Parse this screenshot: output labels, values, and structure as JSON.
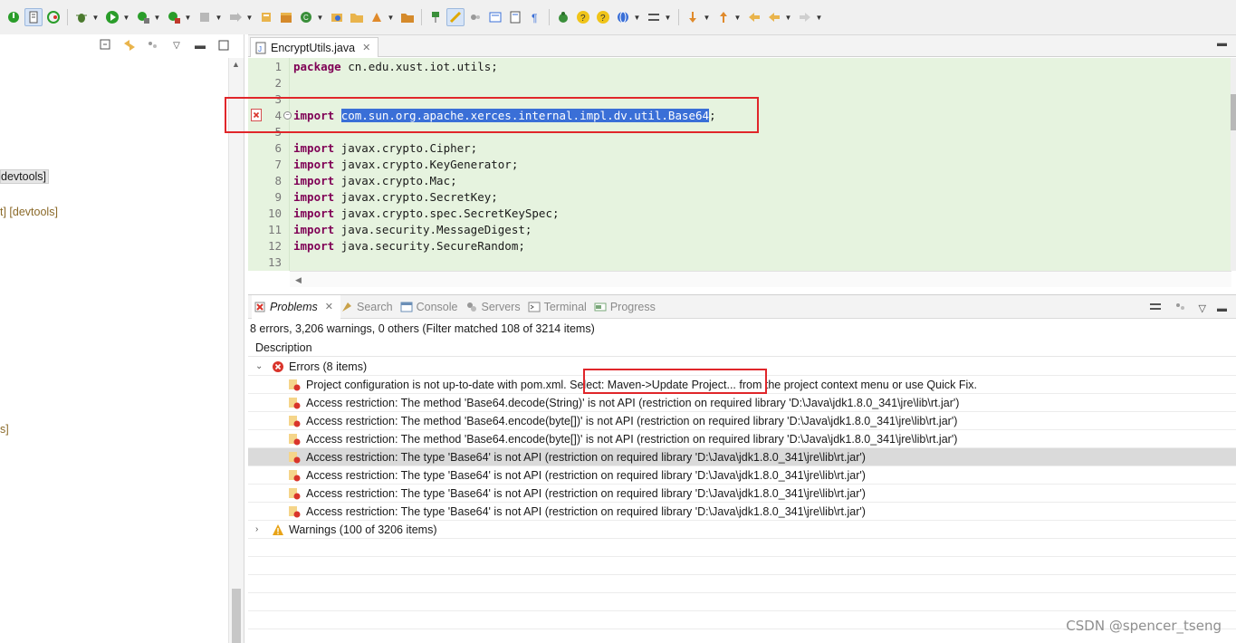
{
  "left_tree": {
    "frag1": "devtools]",
    "frag2": "t] [devtools]",
    "frag3": "s]"
  },
  "editor": {
    "tab_label": "EncryptUtils.java",
    "lines": [
      {
        "no": "1",
        "keyword": "package",
        "text": " cn.edu.xust.iot.utils;"
      },
      {
        "no": "2",
        "keyword": "",
        "text": ""
      },
      {
        "no": "3",
        "keyword": "",
        "text": ""
      },
      {
        "no": "4",
        "keyword": "import",
        "selected": "com.sun.org.apache.xerces.internal.impl.dv.util.Base64",
        "suffix": ";"
      },
      {
        "no": "5",
        "keyword": "",
        "text": ""
      },
      {
        "no": "6",
        "keyword": "import",
        "text": " javax.crypto.Cipher;"
      },
      {
        "no": "7",
        "keyword": "import",
        "text": " javax.crypto.KeyGenerator;"
      },
      {
        "no": "8",
        "keyword": "import",
        "text": " javax.crypto.Mac;"
      },
      {
        "no": "9",
        "keyword": "import",
        "text": " javax.crypto.SecretKey;"
      },
      {
        "no": "10",
        "keyword": "import",
        "text": " javax.crypto.spec.SecretKeySpec;"
      },
      {
        "no": "11",
        "keyword": "import",
        "text": " java.security.MessageDigest;"
      },
      {
        "no": "12",
        "keyword": "import",
        "text": " java.security.SecureRandom;"
      },
      {
        "no": "13",
        "keyword": "",
        "text": ""
      }
    ]
  },
  "problems": {
    "tabs": [
      "Problems",
      "Search",
      "Console",
      "Servers",
      "Terminal",
      "Progress"
    ],
    "summary": "8 errors, 3,206 warnings, 0 others (Filter matched 108 of 3214 items)",
    "column_header": "Description",
    "errors_group": "Errors (8 items)",
    "warnings_group": "Warnings (100 of 3206 items)",
    "first_error_prefix": "Project configuration is not up-to-date with pom.xml.",
    "first_error_highlight": "Select: Maven->Update Project...",
    "first_error_suffix": " from the project context menu or use Quick Fix.",
    "error_items": [
      "Access restriction: The method 'Base64.decode(String)' is not API (restriction on required library 'D:\\Java\\jdk1.8.0_341\\jre\\lib\\rt.jar')",
      "Access restriction: The method 'Base64.encode(byte[])' is not API (restriction on required library 'D:\\Java\\jdk1.8.0_341\\jre\\lib\\rt.jar')",
      "Access restriction: The method 'Base64.encode(byte[])' is not API (restriction on required library 'D:\\Java\\jdk1.8.0_341\\jre\\lib\\rt.jar')",
      "Access restriction: The type 'Base64' is not API (restriction on required library 'D:\\Java\\jdk1.8.0_341\\jre\\lib\\rt.jar')",
      "Access restriction: The type 'Base64' is not API (restriction on required library 'D:\\Java\\jdk1.8.0_341\\jre\\lib\\rt.jar')",
      "Access restriction: The type 'Base64' is not API (restriction on required library 'D:\\Java\\jdk1.8.0_341\\jre\\lib\\rt.jar')",
      "Access restriction: The type 'Base64' is not API (restriction on required library 'D:\\Java\\jdk1.8.0_341\\jre\\lib\\rt.jar')"
    ]
  },
  "watermark": "CSDN @spencer_tseng",
  "colors": {
    "keyword": "#7f0055",
    "editor_bg": "#e6f3df",
    "selection": "#3a6fd7",
    "highlight_box": "#e0262a",
    "error_icon": "#d9342b",
    "warning_icon": "#e8a317"
  }
}
